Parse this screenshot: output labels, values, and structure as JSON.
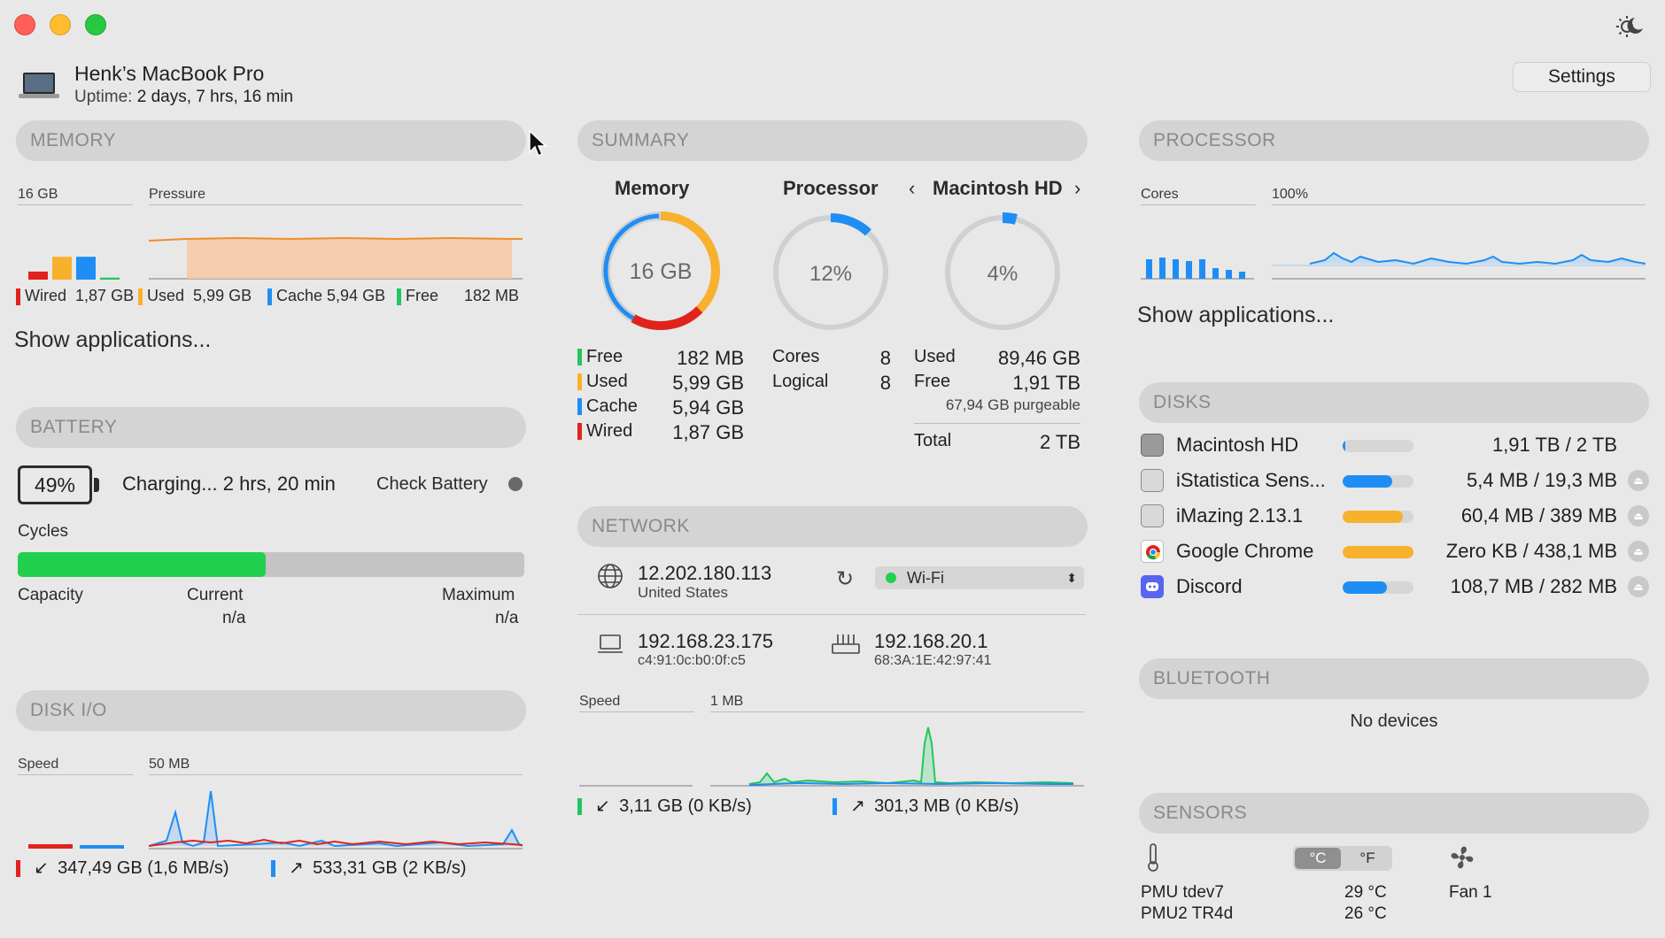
{
  "window": {
    "machine_name": "Henk’s MacBook Pro",
    "uptime_label": "Uptime:",
    "uptime_value": "2 days, 7 hrs, 16 min",
    "settings_label": "Settings"
  },
  "memory": {
    "header": "MEMORY",
    "total": "16 GB",
    "pressure_label": "Pressure",
    "legend": [
      {
        "label": "Wired",
        "value": "1,87 GB",
        "color": "#e0231c"
      },
      {
        "label": "Used",
        "value": "5,99 GB",
        "color": "#f7b12d"
      },
      {
        "label": "Cache",
        "value": "5,94 GB",
        "color": "#1e8ef5"
      },
      {
        "label": "Free",
        "value": "182 MB",
        "color": "#22c55e"
      }
    ],
    "bars": [
      0.12,
      0.34,
      0.34,
      0.03
    ],
    "show_apps": "Show applications..."
  },
  "battery": {
    "header": "BATTERY",
    "percent": "49%",
    "status": "Charging... 2 hrs, 20 min",
    "check": "Check Battery",
    "cycles_label": "Cycles",
    "cycles_fill": 0.49,
    "capacity_label": "Capacity",
    "current_label": "Current",
    "current_value": "n/a",
    "maximum_label": "Maximum",
    "maximum_value": "n/a"
  },
  "diskio": {
    "header": "DISK I/O",
    "speed_label": "Speed",
    "scale_label": "50 MB",
    "read": "347,49 GB (1,6 MB/s)",
    "write": "533,31 GB (2 KB/s)"
  },
  "summary": {
    "header": "SUMMARY",
    "memory_title": "Memory",
    "memory_center": "16 GB",
    "processor_title": "Processor",
    "processor_center": "12%",
    "processor_fraction": 0.12,
    "disk_title": "Macintosh HD",
    "disk_center": "4%",
    "disk_fraction": 0.04,
    "mem_rows": [
      {
        "label": "Free",
        "value": "182 MB",
        "color": "#22c55e"
      },
      {
        "label": "Used",
        "value": "5,99 GB",
        "color": "#f7b12d"
      },
      {
        "label": "Cache",
        "value": "5,94 GB",
        "color": "#1e8ef5"
      },
      {
        "label": "Wired",
        "value": "1,87 GB",
        "color": "#e0231c"
      }
    ],
    "cpu_rows": [
      {
        "label": "Cores",
        "value": "8"
      },
      {
        "label": "Logical",
        "value": "8"
      }
    ],
    "disk_rows": [
      {
        "label": "Used",
        "value": "89,46 GB"
      },
      {
        "label": "Free",
        "value": "1,91 TB"
      }
    ],
    "purgeable": "67,94 GB purgeable",
    "total_label": "Total",
    "total_value": "2 TB"
  },
  "network": {
    "header": "NETWORK",
    "public_ip": "12.202.180.113",
    "country": "United States",
    "interface": "Wi-Fi",
    "local_ip": "192.168.23.175",
    "mac": "c4:91:0c:b0:0f:c5",
    "router_ip": "192.168.20.1",
    "router_mac": "68:3A:1E:42:97:41",
    "speed_label": "Speed",
    "scale_label": "1 MB",
    "download": "3,11 GB (0 KB/s)",
    "upload": "301,3 MB (0 KB/s)"
  },
  "processor": {
    "header": "PROCESSOR",
    "cores_label": "Cores",
    "scale_label": "100%",
    "core_levels": [
      0.55,
      0.6,
      0.55,
      0.5,
      0.55,
      0.3,
      0.25,
      0.2
    ],
    "show_apps": "Show applications..."
  },
  "disks": {
    "header": "DISKS",
    "rows": [
      {
        "name": "Macintosh HD",
        "value": "1,91 TB / 2 TB",
        "fill": 0.04,
        "color": "#1e8ef5",
        "eject": false,
        "icon": "hard-drive-icon"
      },
      {
        "name": "iStatistica Sens...",
        "value": "5,4 MB / 19,3 MB",
        "fill": 0.7,
        "color": "#1e8ef5",
        "eject": true,
        "icon": "disk-image-icon"
      },
      {
        "name": "iMazing 2.13.1",
        "value": "60,4 MB / 389 MB",
        "fill": 0.85,
        "color": "#f7b12d",
        "eject": true,
        "icon": "disk-image-icon"
      },
      {
        "name": "Google Chrome",
        "value": "Zero KB / 438,1 MB",
        "fill": 1.0,
        "color": "#f7b12d",
        "eject": true,
        "icon": "chrome-icon"
      },
      {
        "name": "Discord",
        "value": "108,7 MB / 282 MB",
        "fill": 0.62,
        "color": "#1e8ef5",
        "eject": true,
        "icon": "discord-icon"
      }
    ]
  },
  "bluetooth": {
    "header": "BLUETOOTH",
    "empty": "No devices"
  },
  "sensors": {
    "header": "SENSORS",
    "unit_c": "°C",
    "unit_f": "°F",
    "rows": [
      {
        "label": "PMU tdev7",
        "value": "29 °C"
      },
      {
        "label": "PMU2 TR4d",
        "value": "26 °C"
      }
    ],
    "fan_label": "Fan 1"
  }
}
